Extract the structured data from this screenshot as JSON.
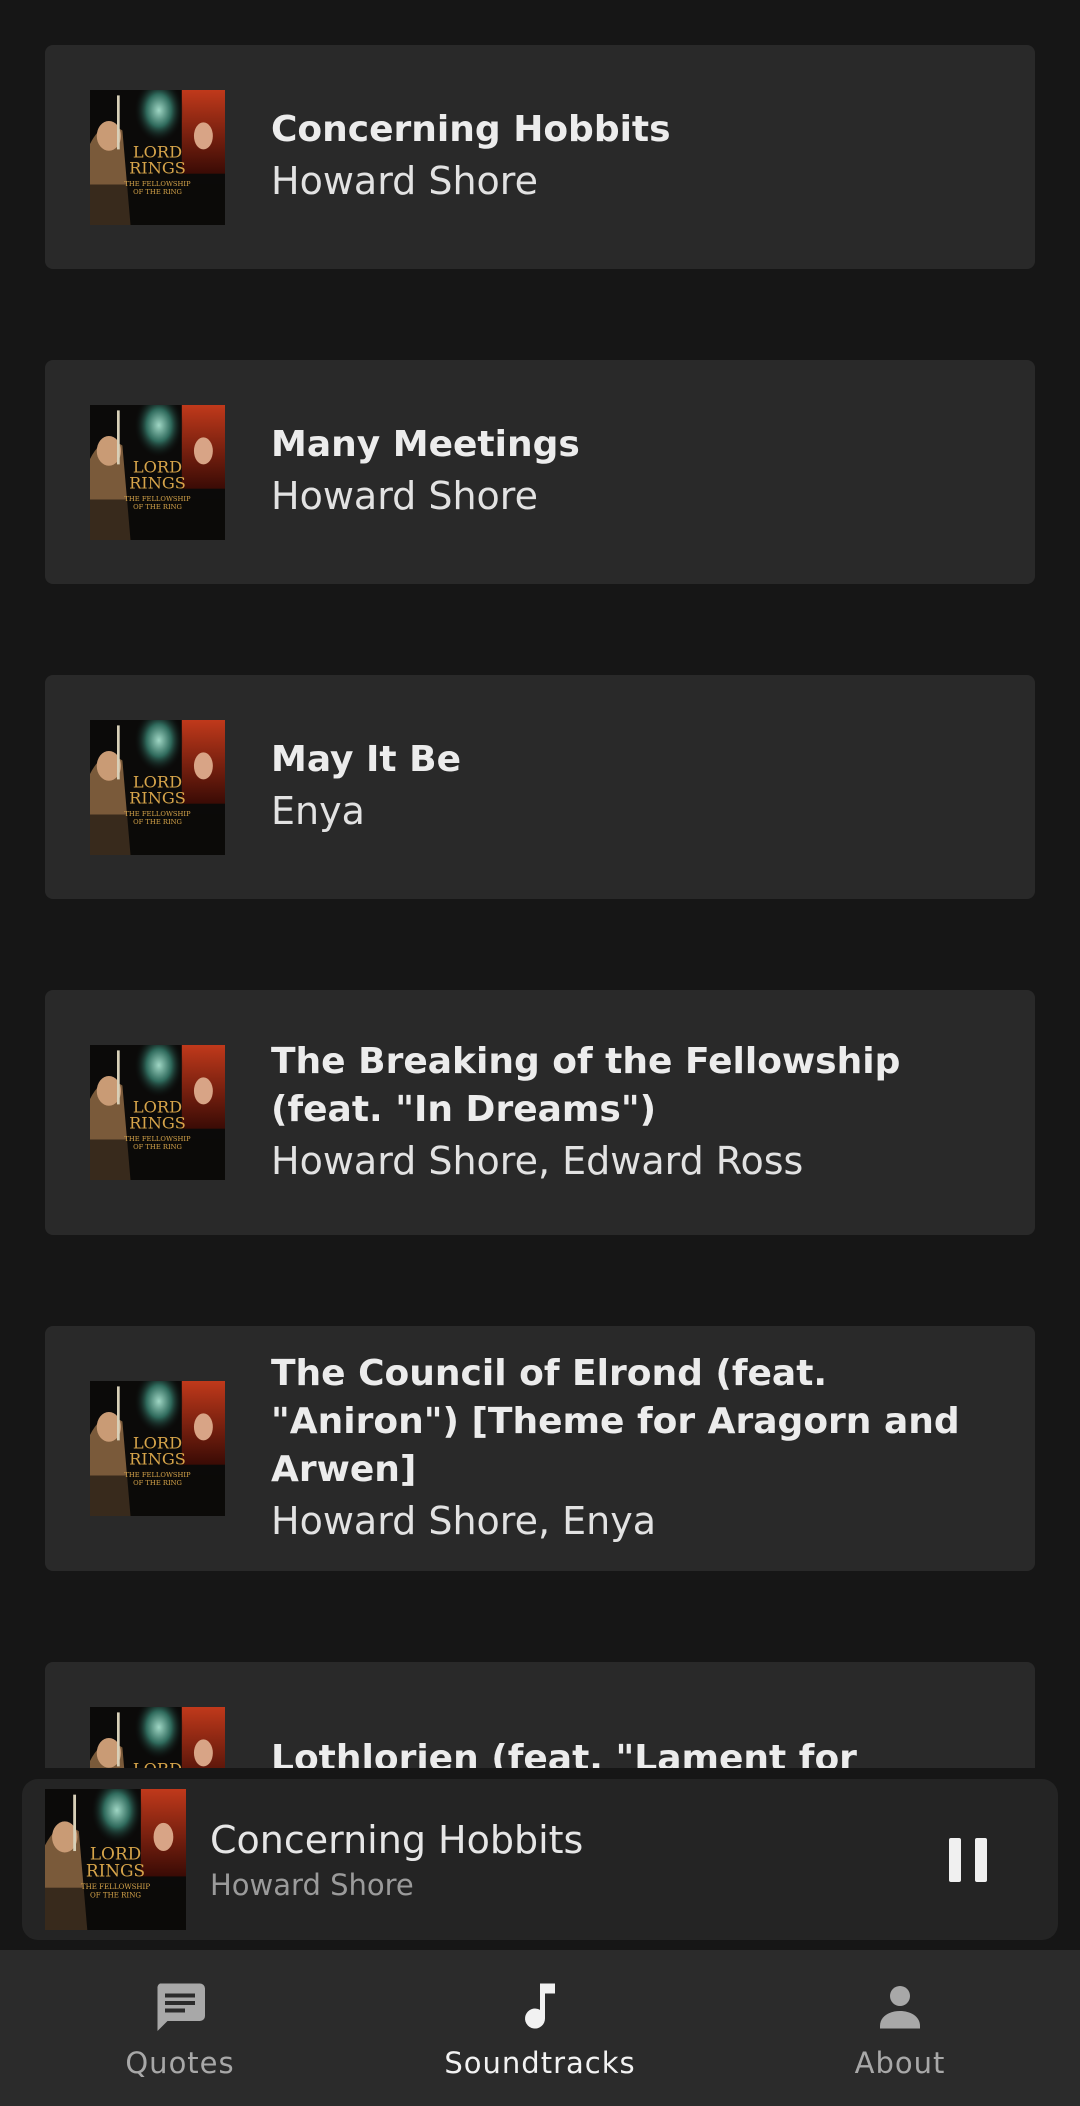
{
  "tracks": [
    {
      "title": "Concerning Hobbits",
      "artist": "Howard Shore"
    },
    {
      "title": "Many Meetings",
      "artist": "Howard Shore"
    },
    {
      "title": "May It Be",
      "artist": "Enya"
    },
    {
      "title": "The Breaking of the Fellowship (feat. \"In Dreams\")",
      "artist": "Howard Shore, Edward Ross"
    },
    {
      "title": "The Council of Elrond (feat. \"Aniron\") [Theme for Aragorn and Arwen]",
      "artist": "Howard Shore, Enya"
    },
    {
      "title": "Lothlorien (feat. \"Lament for Gandalf\")",
      "artist": ""
    }
  ],
  "now_playing": {
    "title": "Concerning Hobbits",
    "artist": "Howard Shore",
    "control_icon": "pause-icon"
  },
  "album_cover": {
    "line1": "LORD",
    "line2": "RINGS",
    "line3": "THE FELLOWSHIP",
    "line4": "OF THE RING"
  },
  "nav": {
    "items": [
      {
        "label": "Quotes",
        "icon": "chat-bubble-icon",
        "active": false
      },
      {
        "label": "Soundtracks",
        "icon": "music-note-icon",
        "active": true
      },
      {
        "label": "About",
        "icon": "person-icon",
        "active": false
      }
    ]
  },
  "colors": {
    "background": "#161616",
    "card": "#292929",
    "player": "#242424",
    "nav_bar": "#2b2b2b",
    "active": "#f2f2f2",
    "inactive": "#a8a8a8"
  }
}
